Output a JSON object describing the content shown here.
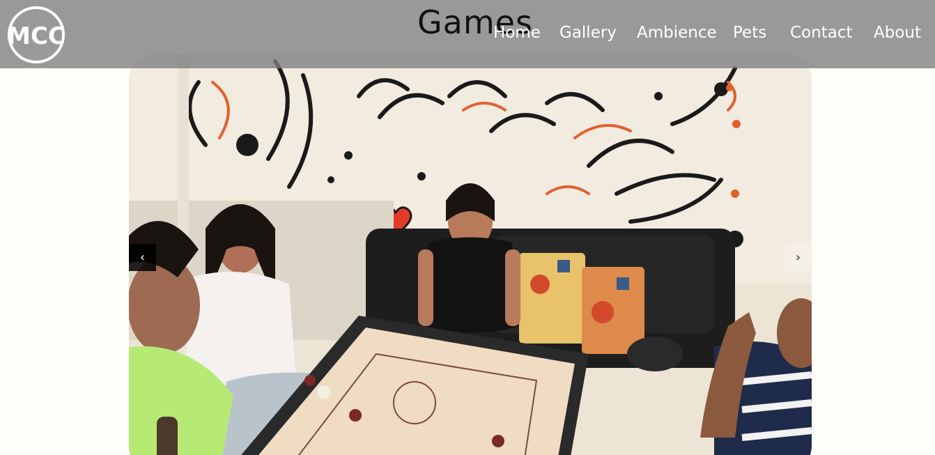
{
  "header": {
    "logo_text": "MCC",
    "title": "Games",
    "nav": [
      {
        "label": "Home"
      },
      {
        "label": "Gallery"
      },
      {
        "label": "Ambience"
      },
      {
        "label": "Pets"
      },
      {
        "label": "Contact"
      },
      {
        "label": "About"
      }
    ]
  },
  "carousel": {
    "prev_label": "‹",
    "next_label": "›",
    "slide_description": "photo"
  },
  "colors": {
    "navbar_bg": "#808080",
    "nav_text": "#ffffff",
    "title_text": "#111111",
    "page_bg": "#fdfdf9"
  }
}
